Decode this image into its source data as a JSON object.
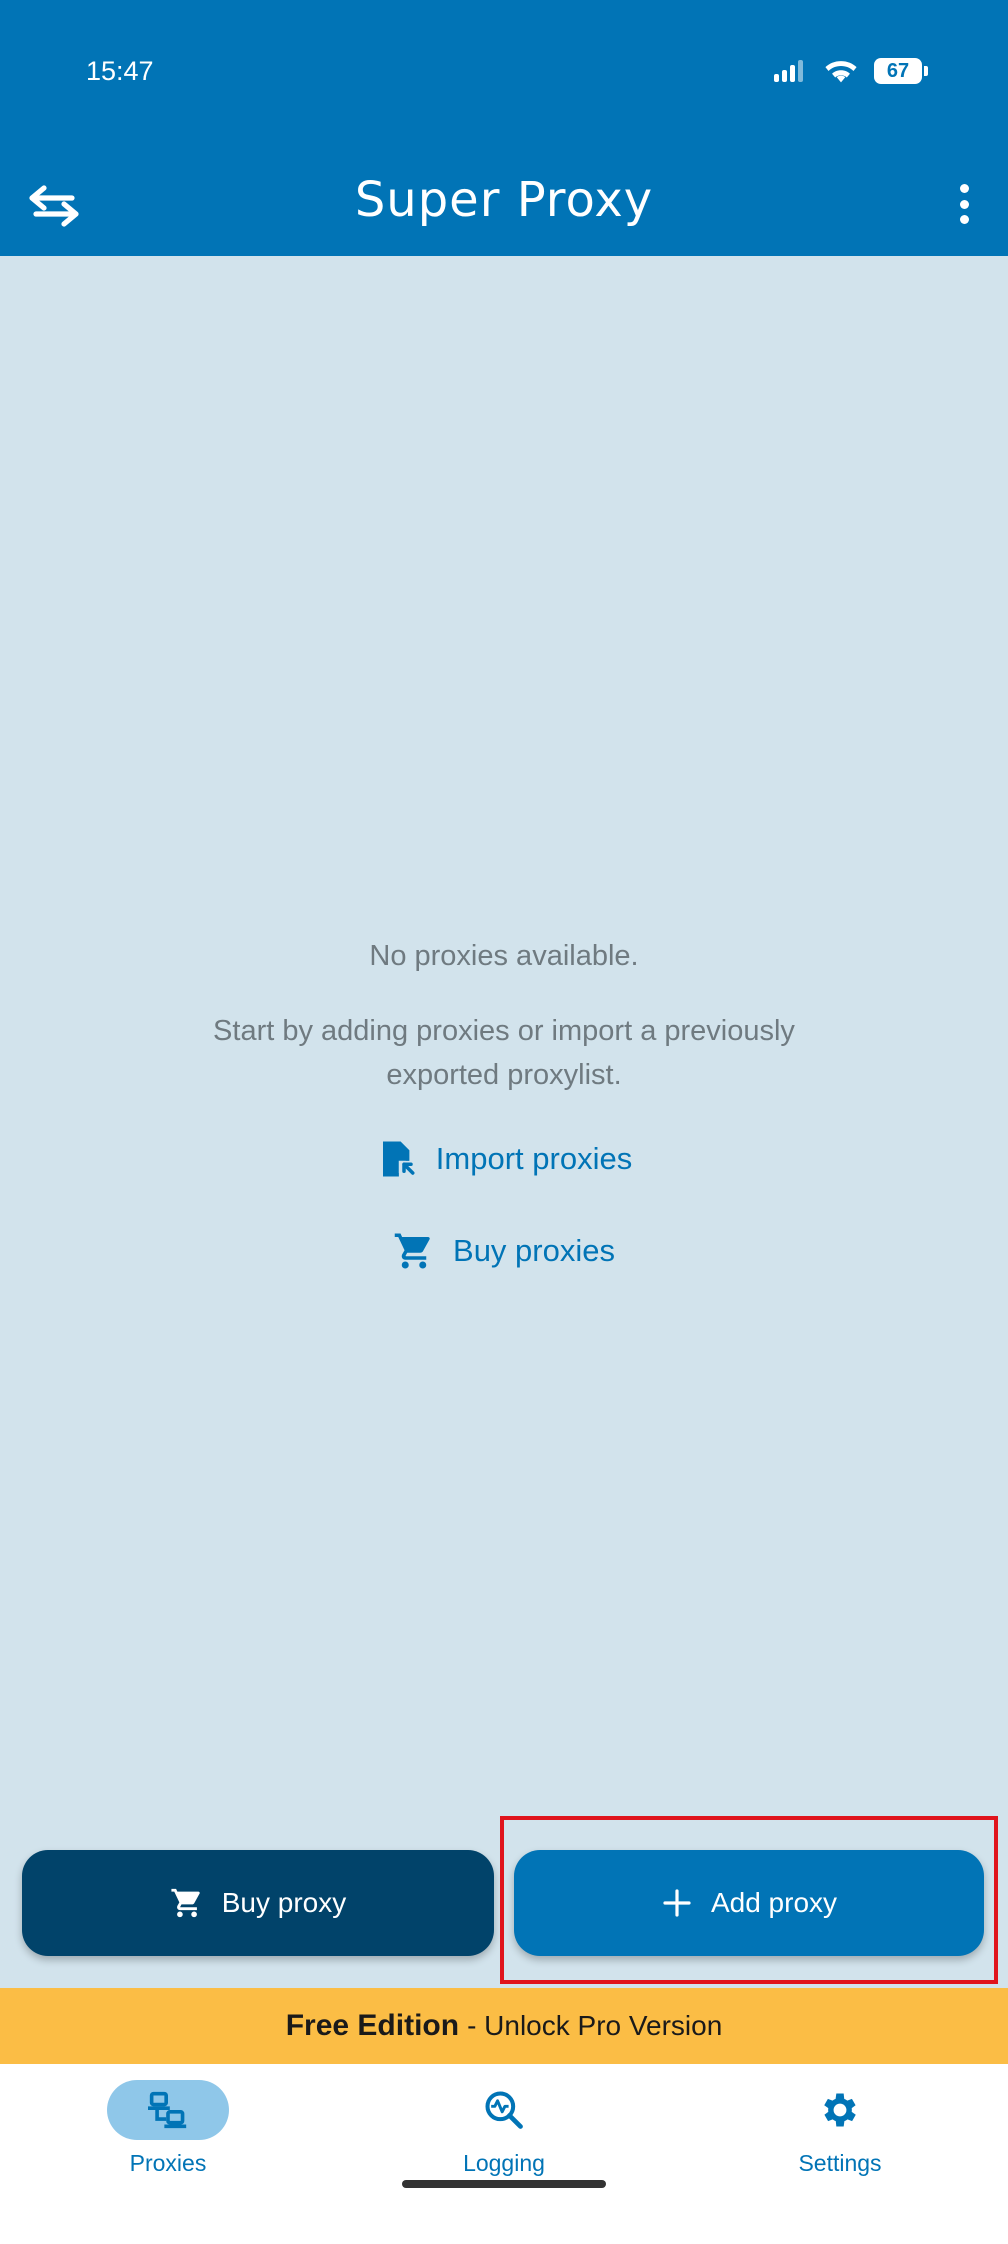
{
  "status_bar": {
    "time": "15:47",
    "battery": "67"
  },
  "app_bar": {
    "title": "Super Proxy"
  },
  "empty_state": {
    "title": "No proxies available.",
    "description": "Start by adding proxies or import a previously exported proxylist.",
    "import_label": "Import proxies",
    "buy_label": "Buy proxies"
  },
  "actions": {
    "buy_proxy": "Buy proxy",
    "add_proxy": "Add proxy"
  },
  "banner": {
    "edition": "Free Edition",
    "cta": "- Unlock Pro Version"
  },
  "bottom_nav": [
    {
      "label": "Proxies",
      "icon": "proxies-icon",
      "active": true
    },
    {
      "label": "Logging",
      "icon": "logging-icon",
      "active": false
    },
    {
      "label": "Settings",
      "icon": "settings-icon",
      "active": false
    }
  ],
  "colors": {
    "primary": "#0174b6",
    "dark_primary": "#01436a",
    "background": "#d2e3ec",
    "banner": "#fbbd45",
    "highlight": "#e0141c"
  }
}
